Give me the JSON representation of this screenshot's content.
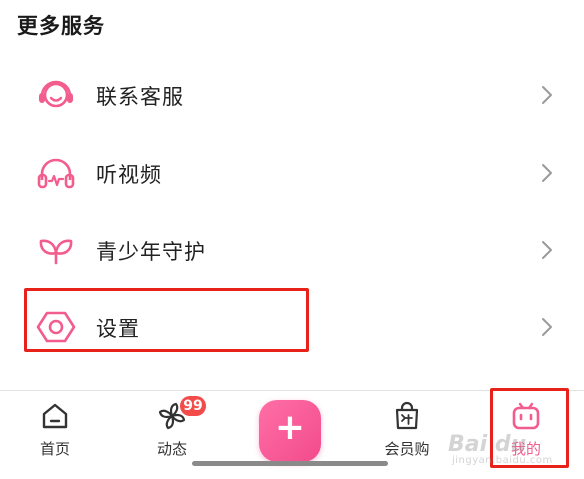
{
  "section": {
    "title": "更多服务"
  },
  "menu": [
    {
      "label": "联系客服",
      "icon": "headset-icon"
    },
    {
      "label": "听视频",
      "icon": "headphones-icon"
    },
    {
      "label": "青少年守护",
      "icon": "sprout-icon"
    },
    {
      "label": "设置",
      "icon": "settings-hexagon-icon"
    }
  ],
  "tabbar": {
    "home": {
      "label": "首页",
      "icon": "home-icon"
    },
    "dynamic": {
      "label": "动态",
      "icon": "pinwheel-icon",
      "badge": "99"
    },
    "publish": {
      "label": "+",
      "icon": "plus-icon"
    },
    "vip_shop": {
      "label": "会员购",
      "icon": "shopping-bag-icon"
    },
    "mine": {
      "label": "我的",
      "icon": "tv-mascot-icon"
    }
  },
  "watermark": {
    "text": "Bai du",
    "sub": "jingyan.baidu.com"
  },
  "colors": {
    "accent": "#f25d8e",
    "highlight": "#e8221b",
    "badge": "#f34a4a"
  }
}
